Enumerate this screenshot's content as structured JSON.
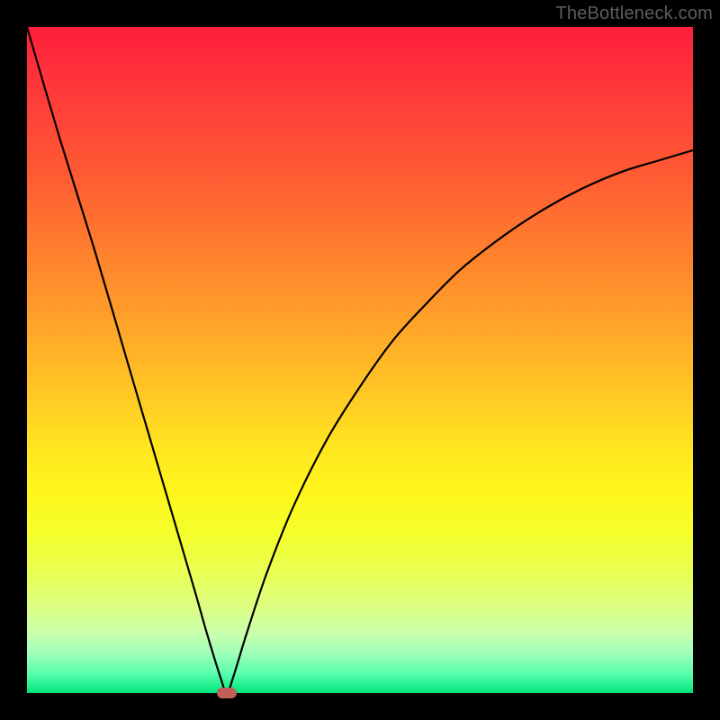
{
  "watermark": "TheBottleneck.com",
  "colors": {
    "frame": "#000000",
    "curve": "#000000",
    "marker": "#c06058",
    "gradient_top": "#ff1e3c",
    "gradient_bottom": "#00e57a"
  },
  "chart_data": {
    "type": "line",
    "title": "",
    "xlabel": "",
    "ylabel": "",
    "xlim": [
      0,
      100
    ],
    "ylim": [
      0,
      100
    ],
    "grid": false,
    "x": [
      0,
      5,
      10,
      15,
      20,
      25,
      27,
      29,
      30,
      31,
      33,
      36,
      40,
      45,
      50,
      55,
      60,
      65,
      70,
      75,
      80,
      85,
      90,
      95,
      100
    ],
    "y": [
      100,
      83,
      67,
      50,
      33,
      16,
      9,
      2.5,
      0,
      2.5,
      9,
      18,
      28,
      38,
      46,
      53,
      58.5,
      63.5,
      67.5,
      71,
      74,
      76.5,
      78.5,
      80,
      81.5
    ],
    "marker": {
      "x": 30,
      "y": 0
    },
    "annotations": []
  }
}
